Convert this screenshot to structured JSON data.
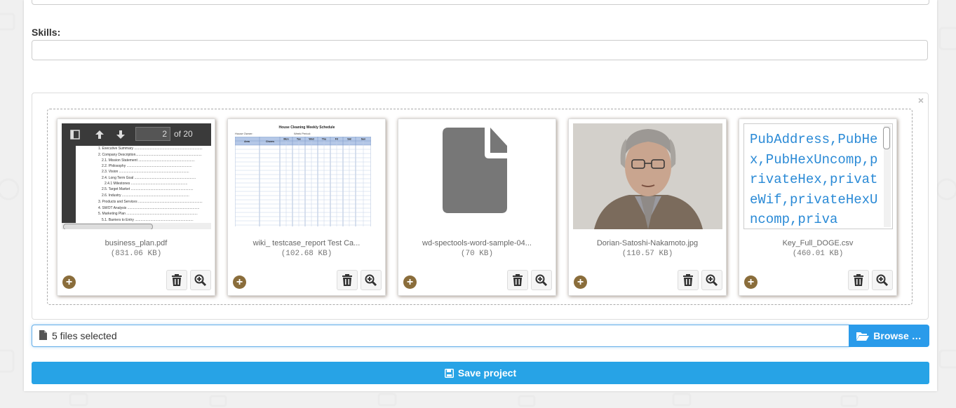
{
  "form": {
    "skills_label": "Skills:",
    "skills_value": ""
  },
  "fileinput": {
    "close_symbol": "×",
    "files": [
      {
        "name": "business_plan.pdf",
        "size": "(831.06 KB)",
        "type": "pdf",
        "pdf": {
          "page": "2",
          "of": "of 20",
          "toc": [
            "1. Executive Summary ......................................................................",
            "2. Company Description....................................................................",
            "2.1. Mission Statement ..........................................................",
            "2.2. Philosophy ...................................................................",
            "2.3. Vision ........................................................................",
            "2.4. Long Term Goal ...............................................................",
            "2.4.1 Milestones ..........................................................",
            "2.5. Target Market ................................................................",
            "2.6. Industry .....................................................................",
            "3. Products and Services ..................................................................",
            "4. SWOT Analysis ..........................................................................",
            "5. Marketing Plan .........................................................................",
            "5.1. Barriers to Entry ............................................................"
          ]
        }
      },
      {
        "name": "wiki_ testcase_report Test Ca...",
        "size": "(102.68 KB)",
        "type": "xls",
        "sheet": {
          "title": "House Cleaning Weekly Schedule",
          "owner": "House Owner:",
          "period": "Week Period:",
          "headers": [
            "Area",
            "Chores",
            "Mon",
            "Tue",
            "Wed",
            "Thu",
            "Fri",
            "Sat",
            "Sun"
          ]
        }
      },
      {
        "name": "wd-spectools-word-sample-04...",
        "size": "(70 KB)",
        "type": "generic"
      },
      {
        "name": "Dorian-Satoshi-Nakamoto.jpg",
        "size": "(110.57 KB)",
        "type": "image"
      },
      {
        "name": "Key_Full_DOGE.csv",
        "size": "(460.01 KB)",
        "type": "csv",
        "csv_text": "PubAddress,PubHex,PubHexUncomp,privateHex,privateWif,privateHexUncomp,priva"
      }
    ],
    "caption": "5 files selected",
    "browse_label": "Browse …"
  },
  "actions": {
    "save_label": "Save project"
  },
  "colors": {
    "primary": "#2a9bea",
    "add_icon": "#8a6d3b",
    "csv_text": "#2a8ad6"
  }
}
